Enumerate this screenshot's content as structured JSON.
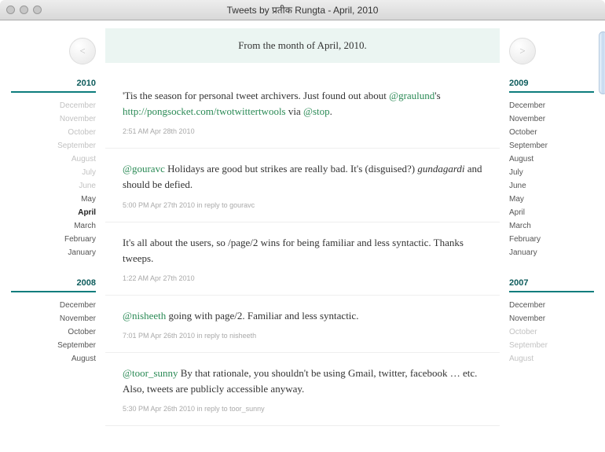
{
  "window": {
    "title": "Tweets by प्रतीक Rungta - April, 2010"
  },
  "nav": {
    "prev_glyph": "<",
    "next_glyph": ">"
  },
  "banner": {
    "text": "From the month of April, 2010."
  },
  "left_years": [
    {
      "year": "2010",
      "months": [
        {
          "label": "December",
          "state": "dim"
        },
        {
          "label": "November",
          "state": "dim"
        },
        {
          "label": "October",
          "state": "dim"
        },
        {
          "label": "September",
          "state": "dim"
        },
        {
          "label": "August",
          "state": "dim"
        },
        {
          "label": "July",
          "state": "dim"
        },
        {
          "label": "June",
          "state": "dim"
        },
        {
          "label": "May",
          "state": "normal"
        },
        {
          "label": "April",
          "state": "current"
        },
        {
          "label": "March",
          "state": "normal"
        },
        {
          "label": "February",
          "state": "normal"
        },
        {
          "label": "January",
          "state": "normal"
        }
      ]
    },
    {
      "year": "2008",
      "months": [
        {
          "label": "December",
          "state": "normal"
        },
        {
          "label": "November",
          "state": "normal"
        },
        {
          "label": "October",
          "state": "normal"
        },
        {
          "label": "September",
          "state": "normal"
        },
        {
          "label": "August",
          "state": "normal"
        }
      ]
    }
  ],
  "right_years": [
    {
      "year": "2009",
      "months": [
        {
          "label": "December",
          "state": "normal"
        },
        {
          "label": "November",
          "state": "normal"
        },
        {
          "label": "October",
          "state": "normal"
        },
        {
          "label": "September",
          "state": "normal"
        },
        {
          "label": "August",
          "state": "normal"
        },
        {
          "label": "July",
          "state": "normal"
        },
        {
          "label": "June",
          "state": "normal"
        },
        {
          "label": "May",
          "state": "normal"
        },
        {
          "label": "April",
          "state": "normal"
        },
        {
          "label": "March",
          "state": "normal"
        },
        {
          "label": "February",
          "state": "normal"
        },
        {
          "label": "January",
          "state": "normal"
        }
      ]
    },
    {
      "year": "2007",
      "months": [
        {
          "label": "December",
          "state": "normal"
        },
        {
          "label": "November",
          "state": "normal"
        },
        {
          "label": "October",
          "state": "dim"
        },
        {
          "label": "September",
          "state": "dim"
        },
        {
          "label": "August",
          "state": "dim"
        }
      ]
    }
  ],
  "tweets": [
    {
      "segments": [
        {
          "t": "text",
          "v": "'Tis the season for personal tweet archivers. Just found out about "
        },
        {
          "t": "mention",
          "v": "@graulund"
        },
        {
          "t": "text",
          "v": "'s "
        },
        {
          "t": "link",
          "v": "http://pongsocket.com/twotwittertwools"
        },
        {
          "t": "text",
          "v": " via "
        },
        {
          "t": "mention",
          "v": "@stop"
        },
        {
          "t": "text",
          "v": "."
        }
      ],
      "meta": "2:51 AM Apr 28th 2010"
    },
    {
      "segments": [
        {
          "t": "mention",
          "v": "@gouravc"
        },
        {
          "t": "text",
          "v": " Holidays are good but strikes are really bad. It's (disguised?) "
        },
        {
          "t": "em",
          "v": "gundagardi"
        },
        {
          "t": "text",
          "v": " and should be defied."
        }
      ],
      "meta": "5:00 PM Apr 27th 2010 in reply to gouravc"
    },
    {
      "segments": [
        {
          "t": "text",
          "v": "It's all about the users, so /page/2 wins for being familiar and less syntactic. Thanks tweeps."
        }
      ],
      "meta": "1:22 AM Apr 27th 2010"
    },
    {
      "segments": [
        {
          "t": "mention",
          "v": "@nisheeth"
        },
        {
          "t": "text",
          "v": " going with page/2. Familiar and less syntactic."
        }
      ],
      "meta": "7:01 PM Apr 26th 2010 in reply to nisheeth"
    },
    {
      "segments": [
        {
          "t": "mention",
          "v": "@toor_sunny"
        },
        {
          "t": "text",
          "v": " By that rationale, you shouldn't be using Gmail, twitter, facebook … etc. Also, tweets are publicly accessible anyway."
        }
      ],
      "meta": "5:30 PM Apr 26th 2010 in reply to toor_sunny"
    }
  ]
}
